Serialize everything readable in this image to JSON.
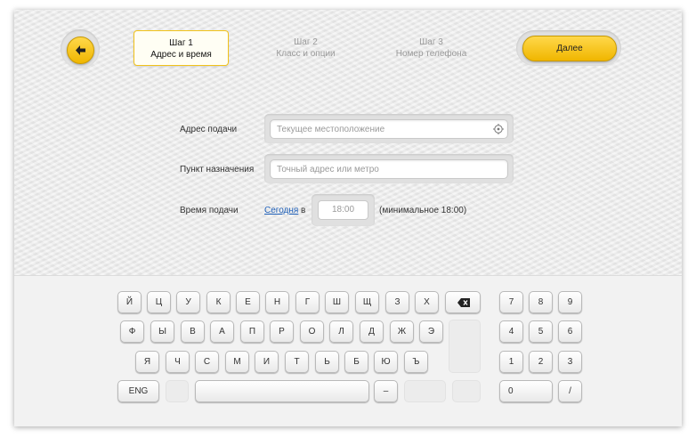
{
  "header": {
    "steps": [
      {
        "title": "Шаг 1",
        "subtitle": "Адрес и время",
        "active": true
      },
      {
        "title": "Шаг 2",
        "subtitle": "Класс и опции",
        "active": false
      },
      {
        "title": "Шаг 3",
        "subtitle": "Номер телефона",
        "active": false
      }
    ],
    "next_label": "Далее",
    "accent_color": "#f5c300"
  },
  "form": {
    "pickup_label": "Адрес подачи",
    "pickup_placeholder": "Текущее местоположение",
    "destination_label": "Пункт назначения",
    "destination_placeholder": "Точный адрес или метро",
    "time_label": "Время подачи",
    "time_day_link": "Сегодня",
    "time_preposition": "в",
    "time_value": "18:00",
    "time_hint": "(минимальное 18:00)"
  },
  "keyboard": {
    "row1": [
      "Й",
      "Ц",
      "У",
      "К",
      "Е",
      "Н",
      "Г",
      "Ш",
      "Щ",
      "З",
      "Х"
    ],
    "row2": [
      "Ф",
      "Ы",
      "В",
      "А",
      "П",
      "Р",
      "О",
      "Л",
      "Д",
      "Ж",
      "Э"
    ],
    "row3": [
      "Я",
      "Ч",
      "С",
      "М",
      "И",
      "Т",
      "Ь",
      "Б",
      "Ю",
      "Ъ"
    ],
    "lang_key": "ENG",
    "dash_key": "–",
    "numpad": [
      "7",
      "8",
      "9",
      "4",
      "5",
      "6",
      "1",
      "2",
      "3"
    ],
    "zero_key": "0",
    "slash_key": "/",
    "backspace_icon": "backspace-icon"
  }
}
